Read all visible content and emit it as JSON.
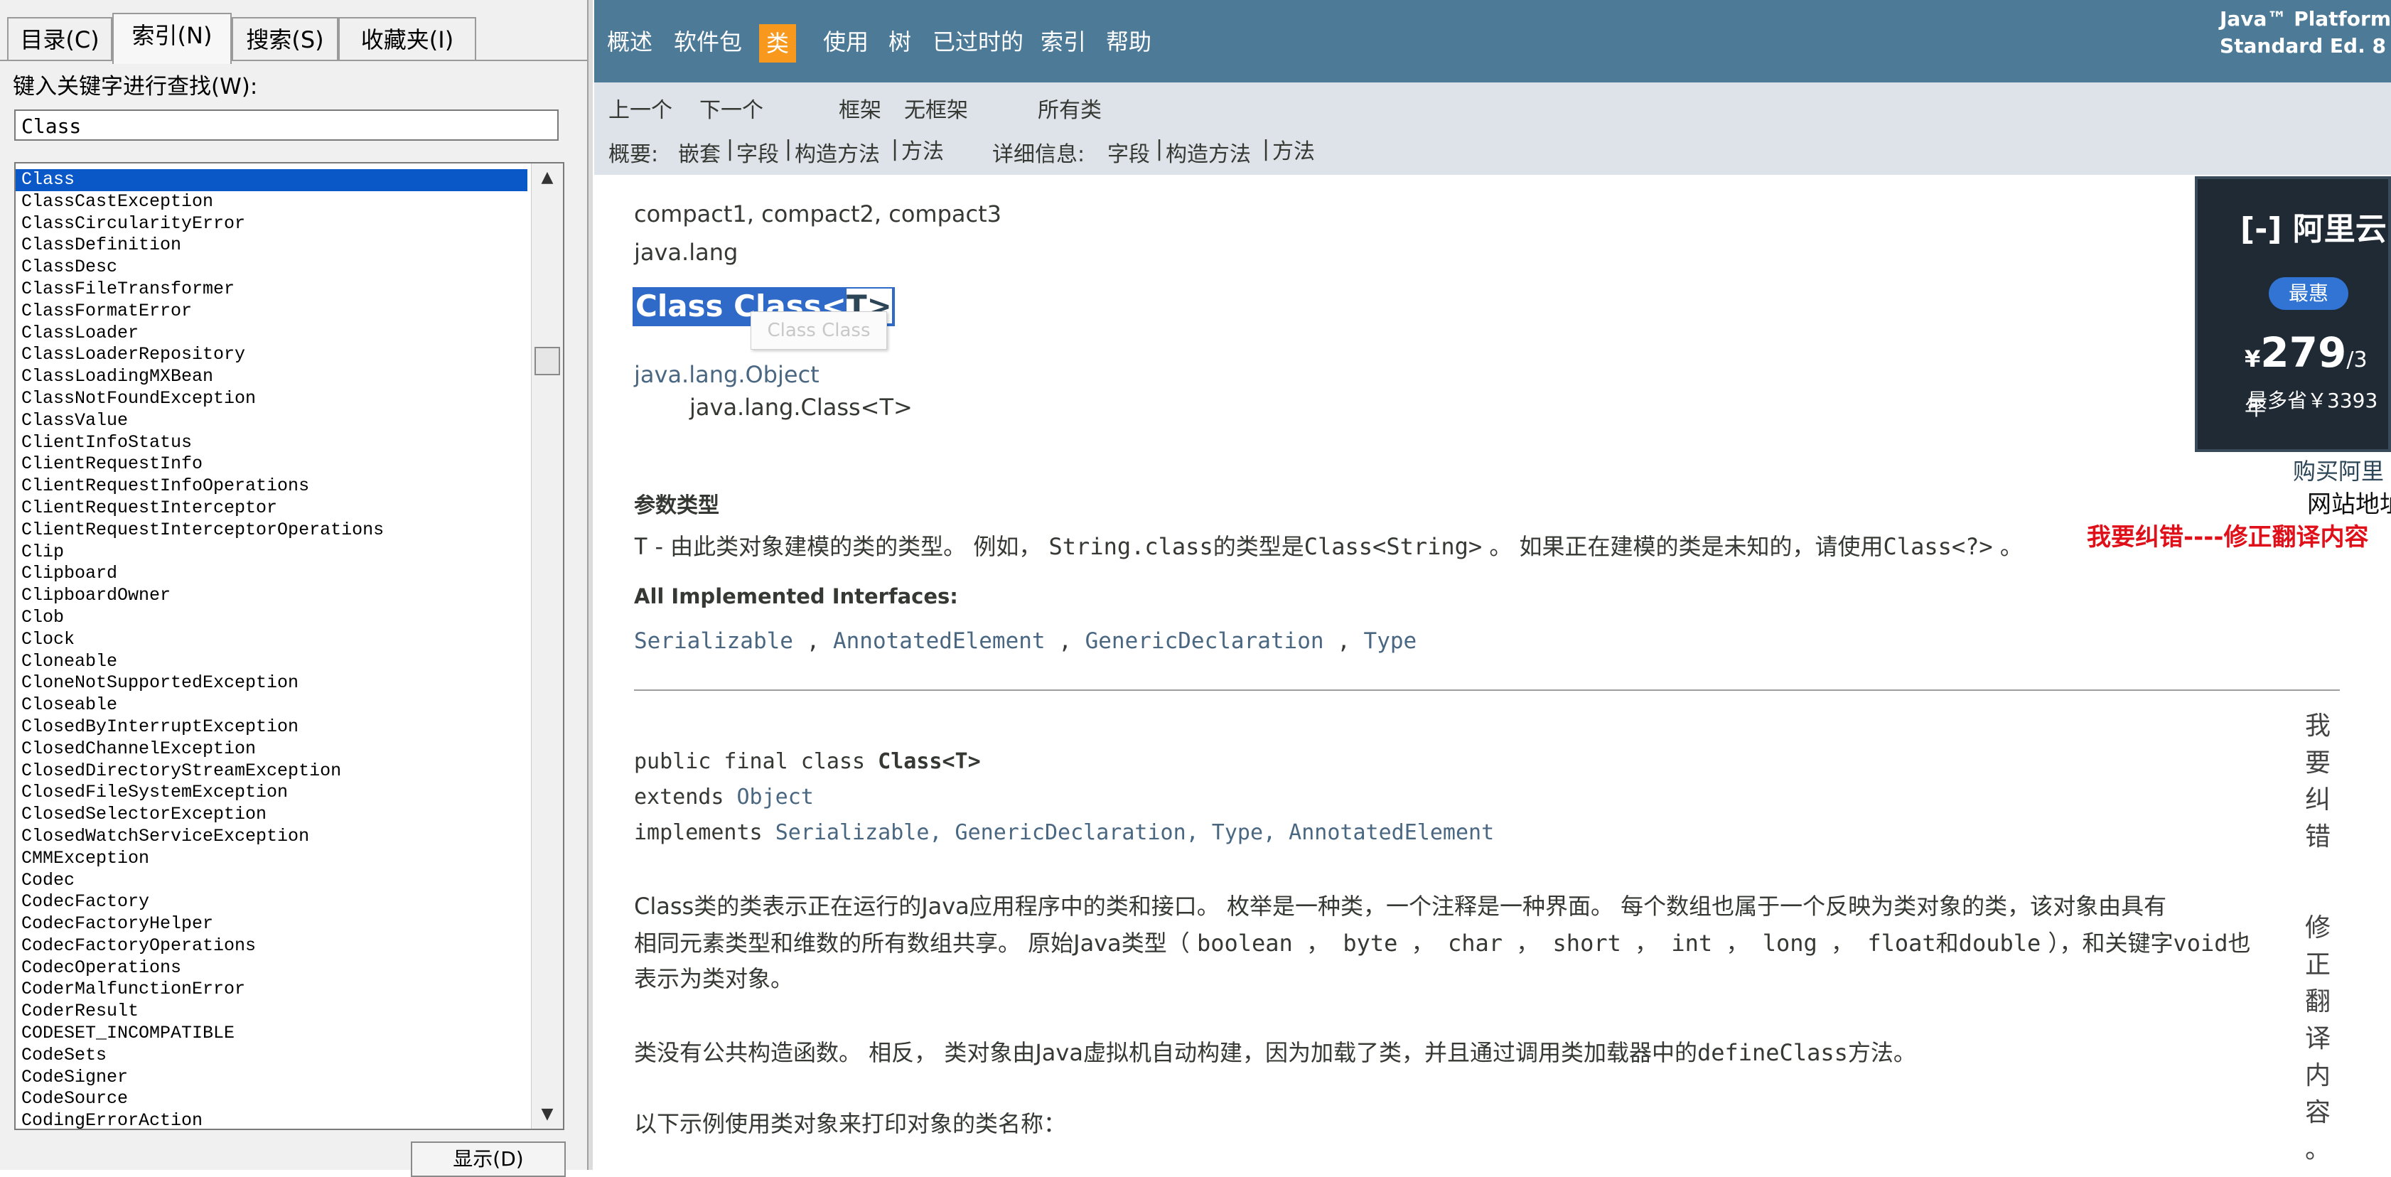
{
  "left": {
    "tabs": [
      {
        "label": "目录(C)"
      },
      {
        "label": "索引(N)"
      },
      {
        "label": "搜索(S)"
      },
      {
        "label": "收藏夹(I)"
      }
    ],
    "search_label": "键入关键字进行查找(W):",
    "search_value": "Class",
    "list": [
      "Class",
      "ClassCastException",
      "ClassCircularityError",
      "ClassDefinition",
      "ClassDesc",
      "ClassFileTransformer",
      "ClassFormatError",
      "ClassLoader",
      "ClassLoaderRepository",
      "ClassLoadingMXBean",
      "ClassNotFoundException",
      "ClassValue",
      "ClientInfoStatus",
      "ClientRequestInfo",
      "ClientRequestInfoOperations",
      "ClientRequestInterceptor",
      "ClientRequestInterceptorOperations",
      "Clip",
      "Clipboard",
      "ClipboardOwner",
      "Clob",
      "Clock",
      "Cloneable",
      "CloneNotSupportedException",
      "Closeable",
      "ClosedByInterruptException",
      "ClosedChannelException",
      "ClosedDirectoryStreamException",
      "ClosedFileSystemException",
      "ClosedSelectorException",
      "ClosedWatchServiceException",
      "CMMException",
      "Codec",
      "CodecFactory",
      "CodecFactoryHelper",
      "CodecFactoryOperations",
      "CodecOperations",
      "CoderMalfunctionError",
      "CoderResult",
      "CODESET_INCOMPATIBLE",
      "CodeSets",
      "CodeSigner",
      "CodeSource",
      "CodingErrorAction"
    ],
    "selected_index": 0,
    "scroll_up": "▲",
    "scroll_down": "▼",
    "display_button": "显示(D)"
  },
  "nav": {
    "items": [
      "概述",
      "软件包",
      "类",
      "使用",
      "树",
      "已过时的",
      "索引",
      "帮助"
    ],
    "active": "类",
    "platform_line1": "Java™ Platform",
    "platform_line2": "Standard Ed. 8"
  },
  "subnav": {
    "prev": "上一个",
    "next": "下一个",
    "frames": "框架",
    "no_frames": "无框架",
    "all_classes": "所有类",
    "summary_label": "概要:",
    "summary_nested": "嵌套",
    "summary_field": "字段",
    "summary_ctor": "构造方法",
    "summary_method": "方法",
    "detail_label": "详细信息:",
    "detail_field": "字段",
    "detail_ctor": "构造方法",
    "detail_method": "方法",
    "sep": "|"
  },
  "doc": {
    "profiles": "compact1, compact2, compact3",
    "package": "java.lang",
    "title_selected": "Class Class<",
    "title_rest": "T>",
    "tooltip": "Class Class",
    "hier_parent": "java.lang.Object",
    "hier_child": "java.lang.Class<T>",
    "type_params_heading": "参数类型",
    "type_param_name": "T",
    "type_param_desc_1": " - 由此类对象建模的类的类型。 例如， ",
    "type_param_code_1": "String.class",
    "type_param_desc_2": "的类型是",
    "type_param_code_2": "Class<String>",
    "type_param_desc_3": " 。 如果正在建模的类是未知的，请使用",
    "type_param_code_3": "Class<?>",
    "type_param_desc_4": " 。",
    "impl_heading": "All Implemented Interfaces:",
    "interfaces": [
      "Serializable",
      "AnnotatedElement",
      "GenericDeclaration",
      "Type"
    ],
    "iface_sep": " , ",
    "decl_kw": "public final class ",
    "decl_name": "Class<T>",
    "decl_extends_kw": "extends ",
    "decl_extends": "Object",
    "decl_impl_kw": "implements ",
    "decl_impls": "Serializable, GenericDeclaration, Type, AnnotatedElement",
    "desc1_line1": "Class类的类表示正在运行的Java应用程序中的类和接口。 枚举是一种类，一个注释是一种界面。 每个数组也属于一个反映为类对象的类，该对象由具有",
    "desc1_line2a": "相同元素类型和维数的所有数组共享。 原始Java类型（ ",
    "desc1_line2_code": "boolean ， byte ， char ， short ， int ， long ， float",
    "desc1_line2b": "和",
    "desc1_line2_code2": "double",
    "desc1_line2c": " ），和关键字",
    "desc1_line2_code3": "void",
    "desc1_line2d": "也",
    "desc1_line3": "表示为类对象。",
    "desc2a": "类没有公共构造函数。 相反， 类对象由Java虚拟机自动构建，因为加载了类，并且通过调用类加载器中的",
    "desc2_code": "defineClass",
    "desc2b": "方法。",
    "desc3": "以下示例使用类对象来打印对象的类名称："
  },
  "ad": {
    "logo": "[-] 阿里云",
    "badge": "最惠",
    "currency": "¥",
    "price": "279",
    "per": "/3年",
    "save": "最多省￥3393",
    "buy": "购买阿里",
    "site": "网站地址"
  },
  "correction": {
    "link": "我要纠错----修正翻译内容",
    "vert1": "我要纠错",
    "vert2": "修正翻译内容。"
  },
  "colors": {
    "nav_bg": "#4d7a97",
    "nav_active": "#f8981d",
    "subnav_bg": "#dee3e9",
    "selection": "#0a58c8",
    "correction_red": "#e0101a"
  }
}
